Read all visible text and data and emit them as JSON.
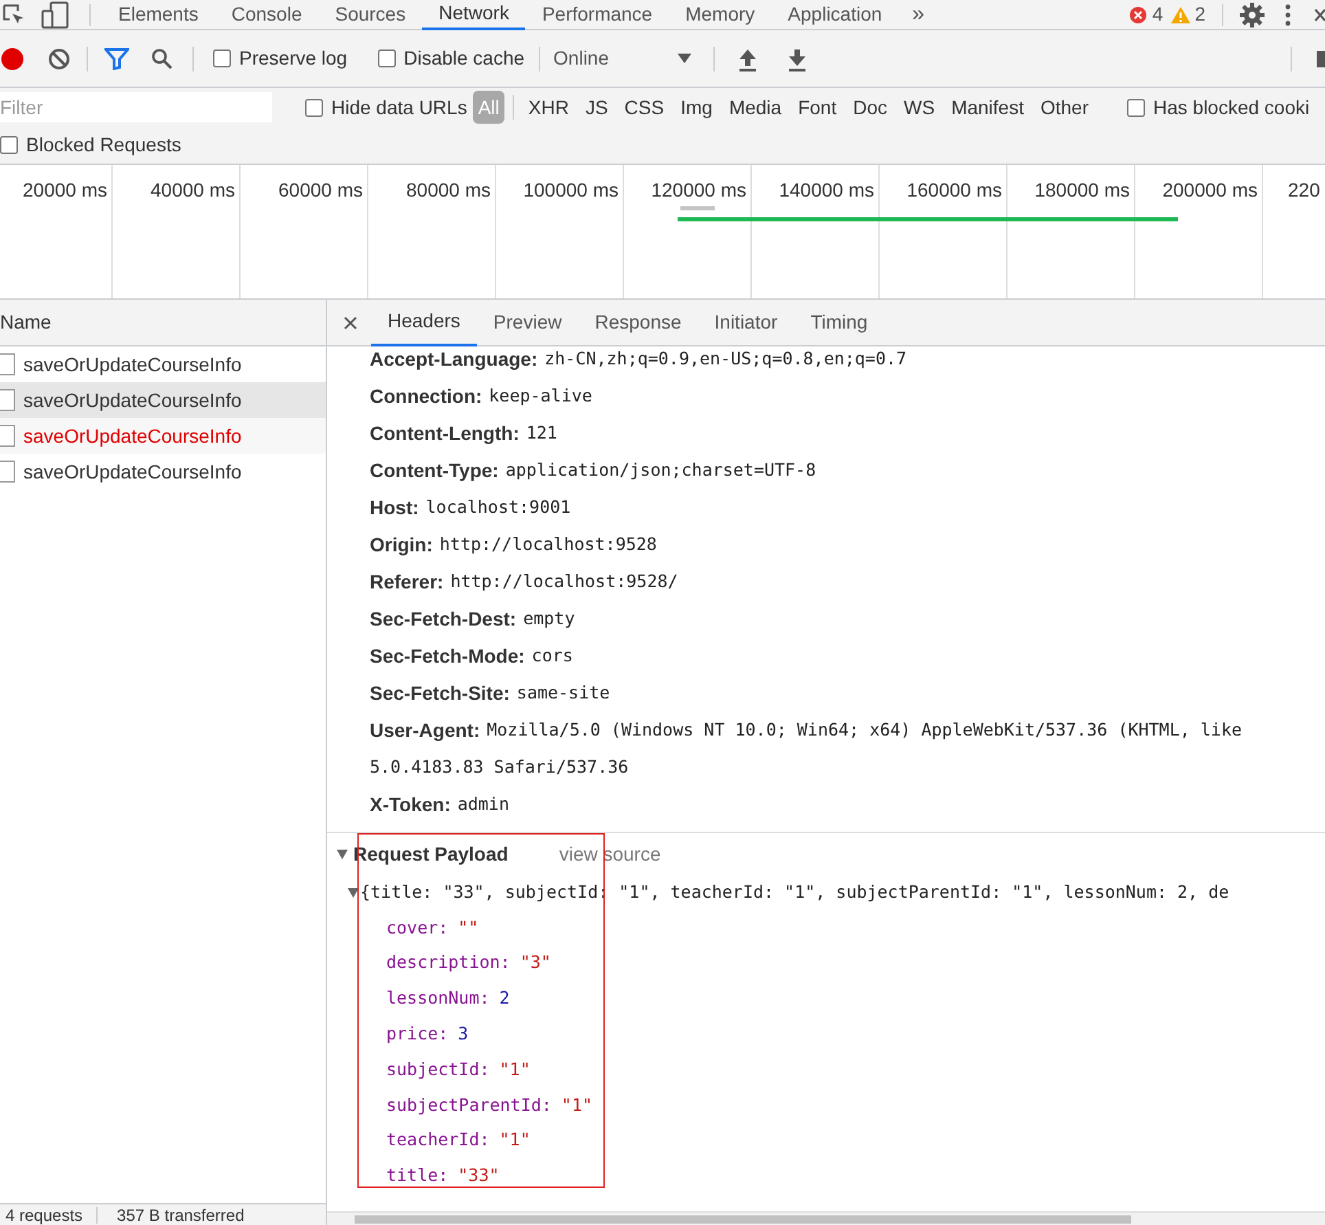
{
  "panel_tabs": [
    {
      "label": "Elements",
      "selected": false
    },
    {
      "label": "Console",
      "selected": false
    },
    {
      "label": "Sources",
      "selected": false
    },
    {
      "label": "Network",
      "selected": true
    },
    {
      "label": "Performance",
      "selected": false
    },
    {
      "label": "Memory",
      "selected": false
    },
    {
      "label": "Application",
      "selected": false
    }
  ],
  "more_tabs": "»",
  "error_count": "4",
  "warning_count": "2",
  "toolbar": {
    "recording": true,
    "preserve_log": {
      "label": "Preserve log",
      "checked": false
    },
    "disable_cache": {
      "label": "Disable cache",
      "checked": false
    },
    "throttling": "Online"
  },
  "filter": {
    "placeholder": "Filter",
    "hide_data_urls": {
      "label": "Hide data URLs",
      "checked": false
    },
    "types": [
      {
        "label": "All",
        "selected": true
      },
      {
        "label": "XHR",
        "selected": false
      },
      {
        "label": "JS",
        "selected": false
      },
      {
        "label": "CSS",
        "selected": false
      },
      {
        "label": "Img",
        "selected": false
      },
      {
        "label": "Media",
        "selected": false
      },
      {
        "label": "Font",
        "selected": false
      },
      {
        "label": "Doc",
        "selected": false
      },
      {
        "label": "WS",
        "selected": false
      },
      {
        "label": "Manifest",
        "selected": false
      },
      {
        "label": "Other",
        "selected": false
      }
    ],
    "has_blocked_cookies": {
      "label": "Has blocked cooki",
      "checked": false
    },
    "blocked_requests": {
      "label": "Blocked Requests",
      "checked": false
    }
  },
  "timeline": {
    "ticks": [
      "20000 ms",
      "40000 ms",
      "60000 ms",
      "80000 ms",
      "100000 ms",
      "120000 ms",
      "140000 ms",
      "160000 ms",
      "180000 ms",
      "200000 ms",
      "220"
    ]
  },
  "requests": {
    "column": "Name",
    "rows": [
      {
        "name": "saveOrUpdateCourseInfo",
        "selected": false,
        "error": false
      },
      {
        "name": "saveOrUpdateCourseInfo",
        "selected": true,
        "error": false
      },
      {
        "name": "saveOrUpdateCourseInfo",
        "selected": false,
        "error": true
      },
      {
        "name": "saveOrUpdateCourseInfo",
        "selected": false,
        "error": false
      }
    ]
  },
  "detail_tabs": [
    {
      "label": "Headers",
      "selected": true
    },
    {
      "label": "Preview",
      "selected": false
    },
    {
      "label": "Response",
      "selected": false
    },
    {
      "label": "Initiator",
      "selected": false
    },
    {
      "label": "Timing",
      "selected": false
    }
  ],
  "headers": [
    {
      "name": "Accept-Language:",
      "value": "zh-CN,zh;q=0.9,en-US;q=0.8,en;q=0.7"
    },
    {
      "name": "Connection:",
      "value": "keep-alive"
    },
    {
      "name": "Content-Length:",
      "value": "121"
    },
    {
      "name": "Content-Type:",
      "value": "application/json;charset=UTF-8"
    },
    {
      "name": "Host:",
      "value": "localhost:9001"
    },
    {
      "name": "Origin:",
      "value": "http://localhost:9528"
    },
    {
      "name": "Referer:",
      "value": "http://localhost:9528/"
    },
    {
      "name": "Sec-Fetch-Dest:",
      "value": "empty"
    },
    {
      "name": "Sec-Fetch-Mode:",
      "value": "cors"
    },
    {
      "name": "Sec-Fetch-Site:",
      "value": "same-site"
    },
    {
      "name": "User-Agent:",
      "value": "Mozilla/5.0 (Windows NT 10.0; Win64; x64) AppleWebKit/537.36 (KHTML, like",
      "continuation": "5.0.4183.83 Safari/537.36"
    },
    {
      "name": "X-Token:",
      "value": "admin"
    }
  ],
  "payload": {
    "title": "Request Payload",
    "expanded": true,
    "view_source": "view source",
    "summary": "{title: \"33\", subjectId: \"1\", teacherId: \"1\", subjectParentId: \"1\", lessonNum: 2, de",
    "fields": [
      {
        "key": "cover:",
        "value": "\"\"",
        "kind": "string"
      },
      {
        "key": "description:",
        "value": "\"3\"",
        "kind": "string"
      },
      {
        "key": "lessonNum:",
        "value": "2",
        "kind": "number"
      },
      {
        "key": "price:",
        "value": "3",
        "kind": "number"
      },
      {
        "key": "subjectId:",
        "value": "\"1\"",
        "kind": "string"
      },
      {
        "key": "subjectParentId:",
        "value": "\"1\"",
        "kind": "string"
      },
      {
        "key": "teacherId:",
        "value": "\"1\"",
        "kind": "string"
      },
      {
        "key": "title:",
        "value": "\"33\"",
        "kind": "string"
      }
    ]
  },
  "annotation": {
    "kind": "rectangle"
  },
  "status_bar": [
    "4 requests",
    "357 B transferred"
  ]
}
